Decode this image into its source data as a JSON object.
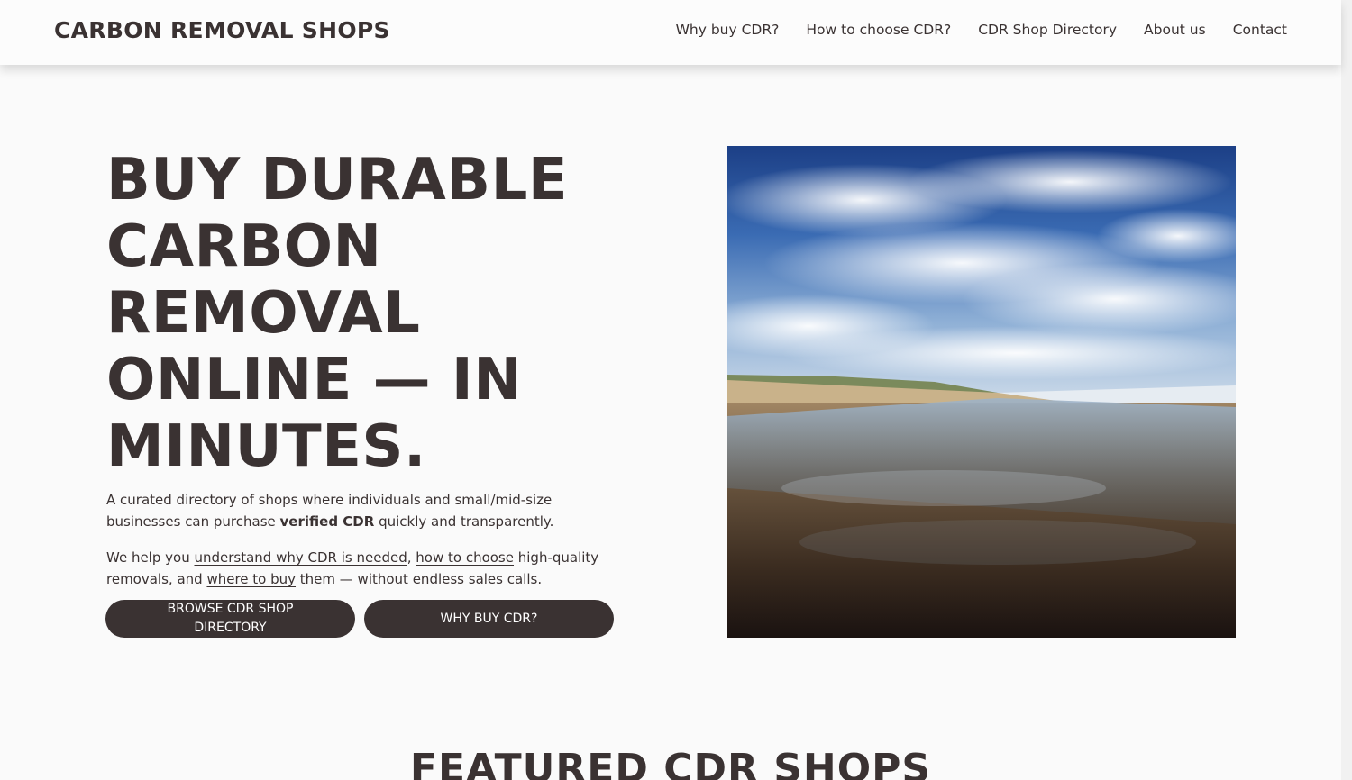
{
  "header": {
    "brand": "CARBON REMOVAL SHOPS",
    "nav": [
      "Why buy CDR?",
      "How to choose CDR?",
      "CDR Shop Directory",
      "About us",
      "Contact"
    ]
  },
  "hero": {
    "title": "BUY DURABLE CARBON REMOVAL ONLINE — IN MINUTES.",
    "sub_part1": "A curated directory of shops where individuals and small/mid-size businesses can purchase ",
    "sub_bold": "verified CDR",
    "sub_part2": " quickly and transparently.",
    "help_prefix": "We help you ",
    "link_understand": "understand why CDR is needed",
    "sep1": ", ",
    "link_choose": "how to choose",
    "help_mid": " high-quality removals, and ",
    "link_where": "where to buy",
    "help_suffix": " them — without endless sales calls.",
    "btn_browse": "BROWSE CDR SHOP DIRECTORY",
    "btn_why": "WHY BUY CDR?",
    "image_icon": "beach-landscape-photo"
  },
  "featured": {
    "title": "FEATURED CDR SHOPS"
  },
  "colors": {
    "text": "#3a3232",
    "button_bg": "#3a3232",
    "button_text": "#ffffff",
    "page_bg": "#fafafa"
  }
}
